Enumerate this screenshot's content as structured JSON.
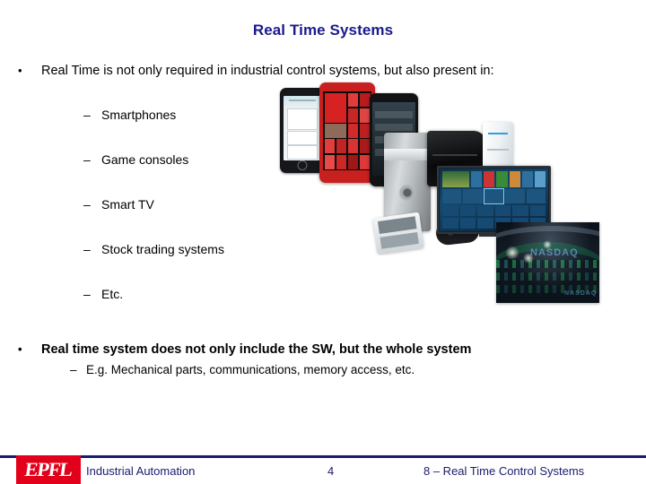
{
  "slide": {
    "title": "Real Time Systems",
    "title_color": "#1a1a8c",
    "background": "#ffffff"
  },
  "content": {
    "bullets": [
      {
        "level": 1,
        "marker": "•",
        "text": "Real Time is not only required in industrial control systems, but also present in:",
        "bold": false
      },
      {
        "level": 2,
        "marker": "–",
        "text": "Smartphones"
      },
      {
        "level": 2,
        "marker": "–",
        "text": "Game consoles"
      },
      {
        "level": 2,
        "marker": "–",
        "text": "Smart TV"
      },
      {
        "level": 2,
        "marker": "–",
        "text": "Stock trading systems"
      },
      {
        "level": 2,
        "marker": "–",
        "text": "Etc."
      },
      {
        "level": 1,
        "marker": "•",
        "text": "Real time system does not only include the SW, but the whole system",
        "bold": true
      },
      {
        "level": 3,
        "marker": "–",
        "text": "E.g. Mechanical parts, communications, memory access, etc."
      }
    ]
  },
  "images": {
    "smartphones_photo": "smartphones-photo",
    "consoles_photo": "game-consoles-photo",
    "smarttv_photo": "smart-tv-photo",
    "trading_photo": "stock-trading-floor-photo",
    "nasdaq_wordmark": "NASDAQ"
  },
  "footer": {
    "logo_text": "EPFL",
    "logo_color": "#e3001b",
    "rule_color": "#1a1a6e",
    "left_label": "Industrial Automation",
    "page_number": "4",
    "right_label": "8 – Real Time Control Systems"
  }
}
